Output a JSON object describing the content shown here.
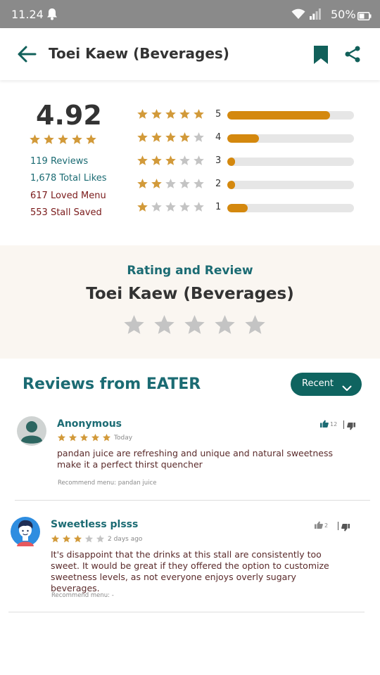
{
  "status_bar": {
    "time": "11.24",
    "battery": "50%"
  },
  "header": {
    "title": "Toei Kaew (Beverages)"
  },
  "summary": {
    "score": "4.92",
    "score_stars": 5,
    "reviews": "119 Reviews",
    "likes": "1,678 Total Likes",
    "loved_menu": "617 Loved Menu",
    "stall_saved": "553 Stall Saved",
    "distribution": [
      {
        "stars": 5,
        "label": "5",
        "fraction": 0.81
      },
      {
        "stars": 4,
        "label": "4",
        "fraction": 0.25
      },
      {
        "stars": 3,
        "label": "3",
        "fraction": 0.06
      },
      {
        "stars": 2,
        "label": "2",
        "fraction": 0.06
      },
      {
        "stars": 1,
        "label": "1",
        "fraction": 0.16
      }
    ]
  },
  "rate_panel": {
    "heading": "Rating and Review",
    "stall_name": "Toei Kaew (Beverages)"
  },
  "reviews_section": {
    "title": "Reviews from EATER",
    "sort_label": "Recent"
  },
  "reviews": [
    {
      "name": "Anonymous",
      "stars": 5,
      "date": "Today",
      "text": "pandan juice are refreshing and unique and natural sweetness make it a perfect thirst quencher",
      "recommend": "Recommend menu: pandan juice",
      "likes": "12"
    },
    {
      "name": "Sweetless plsss",
      "stars": 3,
      "date": "2 days ago",
      "text": "It's disappoint that the drinks at this stall are consistently too sweet. It would be great if they offered the option to customize sweetness levels, as not everyone enjoys overly sugary beverages.",
      "recommend": "Recommend menu: -",
      "likes": "2"
    }
  ],
  "colors": {
    "teal": "#1b6b73",
    "gold_star": "#d29a3a",
    "bar_fill": "#d4880e",
    "panel_bg": "#faf6f1",
    "sort_button": "#0f6460"
  },
  "icons": [
    "bell-icon",
    "wifi-icon",
    "signal-icon",
    "battery-icon",
    "back-arrow-icon",
    "bookmark-icon",
    "share-icon",
    "star-icon",
    "chevron-down-icon",
    "thumbs-up-icon",
    "thumbs-down-icon",
    "avatar-icon"
  ]
}
